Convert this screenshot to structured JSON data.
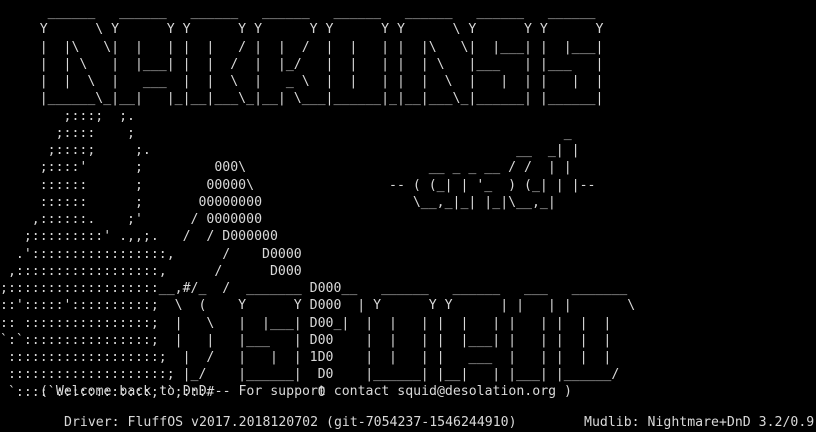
{
  "terminal": {
    "background": "#000000",
    "foreground": "#d9d9d9",
    "banner_art": "      ______   ______   ______   ______   ______   ______   ______   ______\n     Y      \\ Y      Y Y      Y Y      Y Y      Y Y      \\ Y      Y Y      Y\n     |  |\\   \\|  |   | |  |   / |  |  /  |  |   | |  |\\   \\|  |___| |  |___|\n     |  | \\   |  |___| |  |  /  |  |_/   |  |   | |  | \\   |___   | |___   |\n     |  |  \\  |   ___  |  |  \\  |   _ \\  |  |   | |  |  \\  |   |  | |   |  |\n     |______\\_|__|   |_|__|___\\_|__| \\___|______|_|__|___\\_|______| |______|\n        ;:::;  ;.\n       ;::::    ;                                                      _\n      ;::::;     ;.                                              __  _| |\n     ;::::'      ;         000\\                       __ _ _ __ / /  | |\n     ::::::      ;        00000\\                 -- ( (_| | '_  ) (_| | |--\n     ::::::      ;       00000000                   \\__,_|_| |_|\\__,_|\n    ,::::::.    ;'      / 0000000\n   ;:::::::::' .,,;.   /  / D000000\n  .':::::::::::::::::,      /    D0000\n ,::::::::::::::::::,      /      D000\n;:::::::::::::::::::__,#/_  /  _______ D000__   ______   ______   ___   _______\n::':::::'::::::::::;  \\  (    Y      Y D000  | Y      Y Y      | |   | |       \\\n:: ::::::::::::::::;  |   \\   |  |___| D00_|  |  |   | |  |   | |   | |  |  |\n`:`::::::::::::::::;  |   |   |___   | D00    |  |   | |  |___| |   | |  |  |\n :::::::::::::::::::;  |  /   |   |  | 1D0    |  |   | |   ___  |   | |  |  |\n ::::::::::::::::::::; |_/    |______|  D0    |______| |__|   | |___| |______/\n `::::`::::::::::::;'`;:::#             0"
  },
  "welcome_text": "( Welcome back to DnD -- For support contact squid@desolation.org )",
  "footer": {
    "driver": "Driver: FluffOS v2017.2018120702 (git-7054237-1546244910)",
    "mudlib": "Mudlib: Nightmare+DnD 3.2/0.9"
  }
}
